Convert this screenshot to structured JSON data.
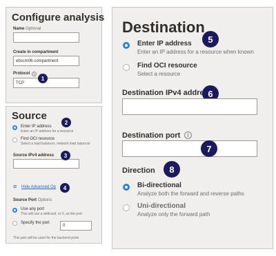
{
  "configure": {
    "title": "Configure analysis",
    "name_label": "Name",
    "name_optional": "Optional",
    "name_value": "",
    "compartment_label": "Create in compartment",
    "compartment_value": "ebscm06-compartment",
    "protocol_label": "Protocol",
    "protocol_value": "TCP",
    "badge": "1"
  },
  "source": {
    "title": "Source",
    "option1_title": "Enter IP address",
    "option1_desc": "Enter an IP address for a resource",
    "option2_title": "Find OCI resource",
    "option2_desc": "Select a load balancer, network load balancer",
    "badge_options": "2",
    "ipv4_label": "Source IPv4 address",
    "ipv4_value": "",
    "badge_ipv4": "3",
    "advanced_link": "Hide Advanced Op",
    "badge_advanced": "4",
    "port_label": "Source Port",
    "port_optional": "Options",
    "any_port_title": "Use any port",
    "any_port_desc": "This will use a wildcard, or 0, as the port",
    "specify_port_title": "Specify the port",
    "specify_port_value": "0",
    "footer_note": "This port will be used for the backend ports"
  },
  "destination": {
    "title": "Destination",
    "badge_title": "5",
    "option1_title": "Enter IP address",
    "option1_desc": "Enter an IP address for a resource when known",
    "option2_title": "Find OCI resource",
    "option2_desc": "Select a resource",
    "ipv4_label": "Destination IPv4 addre",
    "ipv4_value": "",
    "badge_ipv4": "6",
    "port_label": "Destination port",
    "port_value": "",
    "badge_port": "7",
    "direction_label": "Direction",
    "badge_direction": "8",
    "bi_title": "Bi-directional",
    "bi_desc": "Analyze both the forward and reverse paths",
    "uni_title": "Uni-directional",
    "uni_desc": "Analyze only the forward path"
  },
  "icons": {
    "info": "i",
    "hamburger": "≡"
  },
  "colors": {
    "accent": "#2c7fdb",
    "badge": "#1b1a5c",
    "panel": "#f1efed"
  }
}
